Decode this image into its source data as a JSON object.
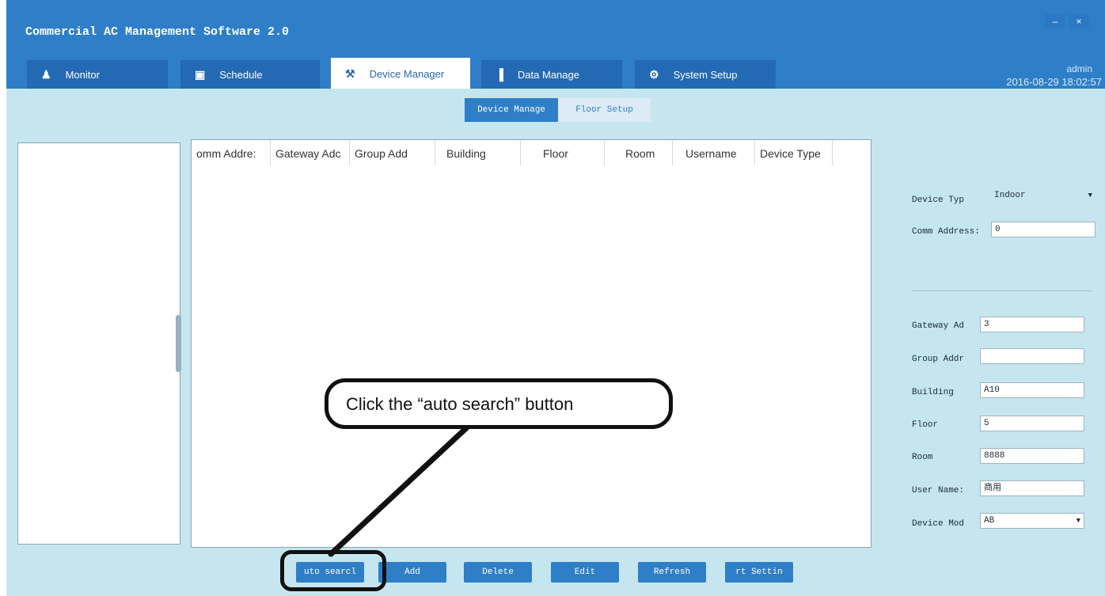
{
  "window": {
    "title": "Commercial AC Management Software 2.0",
    "minimize_label": "–",
    "close_label": "×"
  },
  "tabs": [
    {
      "label": "Monitor",
      "icon": "user-icon",
      "glyph": "♟"
    },
    {
      "label": "Schedule",
      "icon": "calendar-icon",
      "glyph": "▣"
    },
    {
      "label": "Device Manager",
      "icon": "wrench-icon",
      "glyph": "⚒",
      "active": true
    },
    {
      "label": "Data Manage",
      "icon": "bar-chart-icon",
      "glyph": "▐"
    },
    {
      "label": "System Setup",
      "icon": "gear-icon",
      "glyph": "⚙"
    }
  ],
  "header": {
    "user": "admin",
    "datetime": "2016-08-29 18:02:57"
  },
  "subtabs": {
    "device_manage": "Device Manage",
    "floor_setup": "Floor Setup"
  },
  "table": {
    "columns": [
      "omm Addre:",
      "Gateway Adc",
      "Group Add",
      "Building",
      "Floor",
      "Room",
      "Username",
      "Device Type"
    ],
    "rows": []
  },
  "form": {
    "device_type": {
      "label": "Device Typ",
      "value": "Indoor"
    },
    "comm_address": {
      "label": "Comm Address:",
      "value": "0"
    },
    "gateway_address": {
      "label": "Gateway Ad",
      "value": "3"
    },
    "group_address": {
      "label": "Group Addr",
      "value": ""
    },
    "building": {
      "label": "Building",
      "value": "A10"
    },
    "floor": {
      "label": "Floor",
      "value": "5"
    },
    "room": {
      "label": "Room",
      "value": "8888"
    },
    "user_name": {
      "label": "User Name:",
      "value": "商用"
    },
    "device_model": {
      "label": "Device Mod",
      "value": "AB"
    }
  },
  "buttons": {
    "auto_search": "uto searcl",
    "add": "Add",
    "delete": "Delete",
    "edit": "Edit",
    "refresh": "Refresh",
    "port_setting": "rt Settin"
  },
  "annotation": {
    "callout_text": "Click the “auto search” button"
  },
  "colors": {
    "titlebar": "#2f7fc8",
    "content_bg": "#c5e6ef",
    "button": "#2f7fc8"
  }
}
